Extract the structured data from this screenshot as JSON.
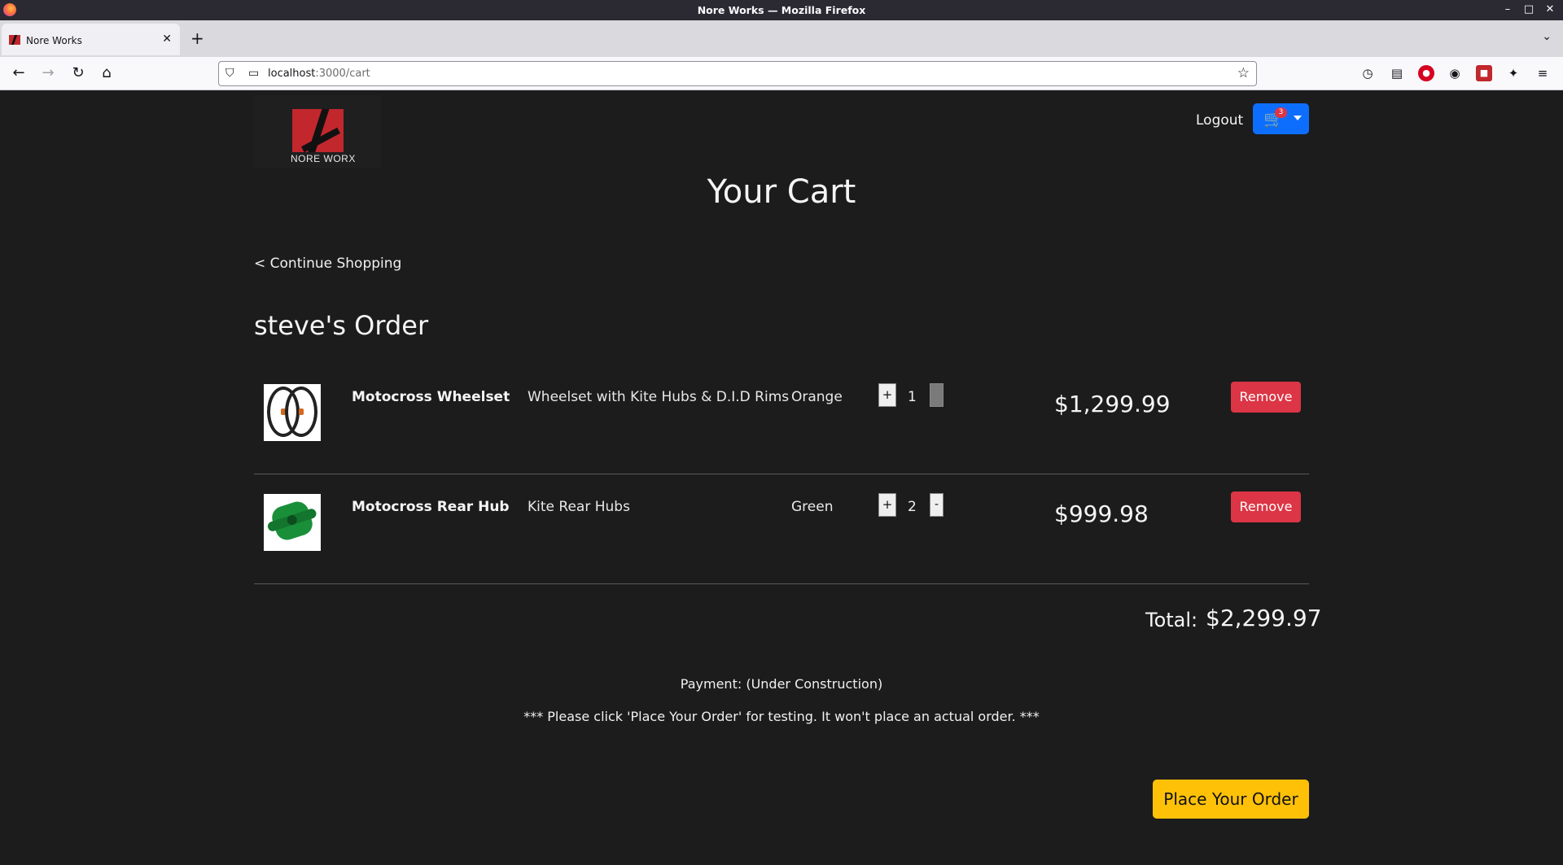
{
  "browser": {
    "window_title": "Nore Works — Mozilla Firefox",
    "tab_title": "Nore Works",
    "url_host": "localhost",
    "url_path": ":3000/cart"
  },
  "header": {
    "brand_text": "NORE WORX",
    "logout_label": "Logout",
    "cart_count": "3"
  },
  "main": {
    "title": "Your Cart",
    "continue_label": "< Continue Shopping",
    "order_title": "steve's Order",
    "items": [
      {
        "name": "Motocross Wheelset",
        "description": "Wheelset with Kite Hubs & D.I.D Rims",
        "color": "Orange",
        "plus_label": "+",
        "quantity": "1",
        "minus_label": "-",
        "price": "$1,299.99",
        "remove_label": "Remove"
      },
      {
        "name": "Motocross Rear Hub",
        "description": "Kite Rear Hubs",
        "color": "Green",
        "plus_label": "+",
        "quantity": "2",
        "minus_label": "-",
        "price": "$999.98",
        "remove_label": "Remove"
      }
    ],
    "total_label": "Total:",
    "total_value": "$2,299.97",
    "payment_text": "Payment: (Under Construction)",
    "notice_text": "*** Please click 'Place Your Order' for testing. It won't place an actual order. ***",
    "place_order_label": "Place Your Order"
  },
  "colors": {
    "background": "#1c1c1c",
    "cart_button": "#0d6efd",
    "remove_button": "#dc3545",
    "place_order_button": "#ffc107"
  }
}
